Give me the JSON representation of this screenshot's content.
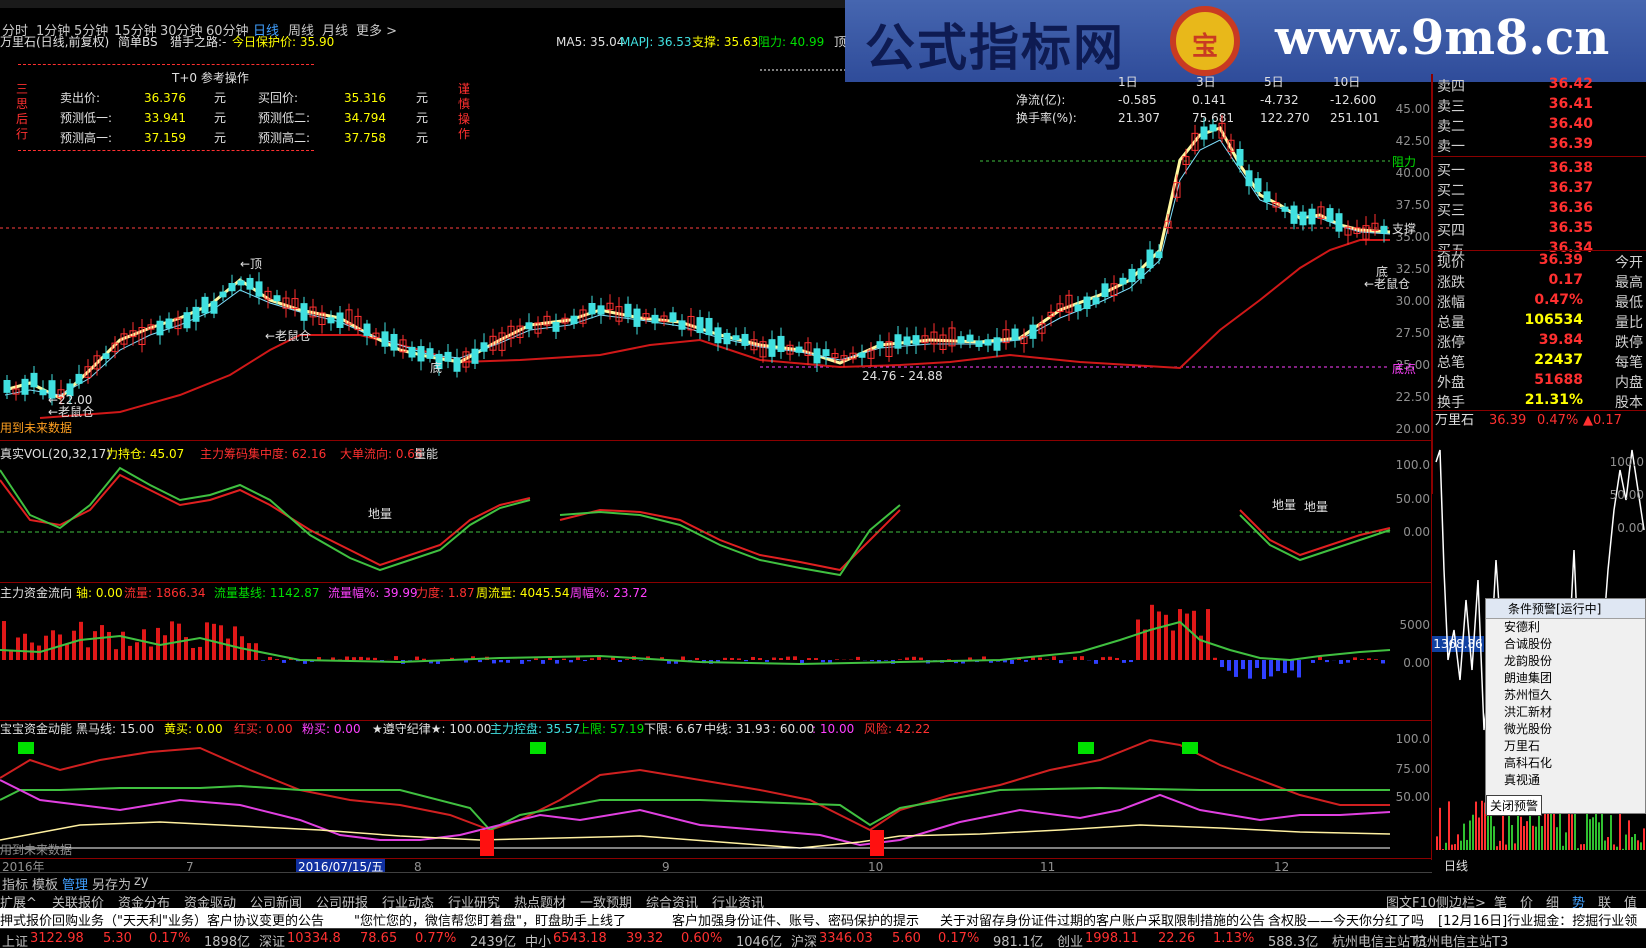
{
  "periods": [
    "分时",
    "1分钟",
    "5分钟",
    "15分钟",
    "30分钟",
    "60分钟",
    "日线",
    "周线",
    "月线",
    "更多 >"
  ],
  "banner": {
    "left": "公式指标网",
    "logo": "宝",
    "right": "www.9m8.cn"
  },
  "chart_header": {
    "title": "万里石(日线,前复权)",
    "mode": "简单BS",
    "hunter": "猎手之路:-",
    "protect": "今日保护价: 35.90",
    "ma5": "MA5: 35.04",
    "mapj": "MAPJ: 36.53",
    "support": "支撑: 35.63",
    "resist": "阻力: 40.99",
    "top": "顶"
  },
  "t0": {
    "title": "T+0 参考操作",
    "side_left": [
      "三",
      "思",
      "后",
      "行"
    ],
    "side_right": [
      "谨",
      "慎",
      "操",
      "作"
    ],
    "rows": [
      [
        "卖出价:",
        "36.376",
        "元",
        "买回价:",
        "35.316",
        "元"
      ],
      [
        "预测低一:",
        "33.941",
        "元",
        "预测低二:",
        "34.794",
        "元"
      ],
      [
        "预测高一:",
        "37.159",
        "元",
        "预测高二:",
        "37.758",
        "元"
      ]
    ]
  },
  "flow_table": {
    "headers": [
      "1日",
      "3日",
      "5日",
      "10日"
    ],
    "rows": [
      {
        "label": "净流(亿):",
        "values": [
          "-0.585",
          "0.141",
          "-4.732",
          "-12.600"
        ]
      },
      {
        "label": "换手率(%):",
        "values": [
          "21.307",
          "75.681",
          "122.270",
          "251.101"
        ]
      }
    ]
  },
  "main_axis": [
    "45.00",
    "42.50",
    "40.00",
    "37.50",
    "35.00",
    "32.50",
    "30.00",
    "27.50",
    "25.00",
    "22.50",
    "20.00"
  ],
  "annotations": {
    "resist": "阻力",
    "support": "支撑",
    "bottom": "底点",
    "ding": "←顶",
    "low_label": "←22.00",
    "laoshu1": "←老鼠仓",
    "laoshu2": "←老鼠仓",
    "laoshu3": "←老鼠仓",
    "di1": "底",
    "di2": "底",
    "range": "24.76 - 24.88",
    "future": "用到未来数据"
  },
  "vol_header": {
    "name": "真实VOL(20,32,17)",
    "a": "力持仓: 45.07",
    "b": "主力筹码集中度: 62.16",
    "c": "大单流向: 0.68",
    "d": "量能"
  },
  "vol_axis": [
    "100.0",
    "50.00",
    "0.00"
  ],
  "vol_marks": [
    "地量",
    "地量",
    "地量"
  ],
  "flow_header": {
    "name": "主力资金流向",
    "axis": "轴: 0.00",
    "flow": "流量: 1866.34",
    "base": "流量基线: 1142.87",
    "amp": "流量幅%: 39.99",
    "force": "力度: 1.87",
    "week": "周流量: 4045.54",
    "wamp": "周幅%: 23.72"
  },
  "flow_axis": [
    "5000",
    "0.00"
  ],
  "flow_value": "1368.86",
  "bao_header": {
    "name": "宝宝资金动能",
    "black": "黑马线: 15.00",
    "yellow": "黄买: 0.00",
    "red": "红买: 0.00",
    "pink": "粉买: 0.00",
    "rule": "★遵守纪律★: 100.00",
    "ctrl": "主力控盘: 35.57",
    "up": "上限: 57.19",
    "down": "下限: 6.67",
    "mid": "中线: 31.93",
    "p60": ": 60.00",
    "p10": ": 10.00",
    "risk": "风险: 42.22"
  },
  "bao_axis": [
    "100.0",
    "75.00",
    "50.00"
  ],
  "bao_future": "用到未来数据",
  "date_axis": {
    "year": "2016年",
    "m7": "7",
    "sel": "2016/07/15/五",
    "m8": "8",
    "m9": "9",
    "m10": "10",
    "m11": "11",
    "m12": "12",
    "rlabel": "日线"
  },
  "quote": {
    "asks": [
      {
        "label": "卖四",
        "price": "36.42"
      },
      {
        "label": "卖三",
        "price": "36.41"
      },
      {
        "label": "卖二",
        "price": "36.40"
      },
      {
        "label": "卖一",
        "price": "36.39"
      }
    ],
    "bids": [
      {
        "label": "买一",
        "price": "36.38"
      },
      {
        "label": "买二",
        "price": "36.37"
      },
      {
        "label": "买三",
        "price": "36.36"
      },
      {
        "label": "买四",
        "price": "36.35"
      },
      {
        "label": "买五",
        "price": "36.34"
      }
    ],
    "stats": [
      {
        "l": "现价",
        "v": "36.39",
        "l2": "今开"
      },
      {
        "l": "涨跌",
        "v": "0.17",
        "l2": "最高"
      },
      {
        "l": "涨幅",
        "v": "0.47%",
        "l2": "最低"
      },
      {
        "l": "总量",
        "v": "106534",
        "l2": "量比"
      },
      {
        "l": "涨停",
        "v": "39.84",
        "l2": "跌停"
      },
      {
        "l": "总笔",
        "v": "22437",
        "l2": "每笔"
      },
      {
        "l": "外盘",
        "v": "51688",
        "l2": "内盘"
      },
      {
        "l": "换手",
        "v": "21.31%",
        "l2": "股本"
      }
    ],
    "name": "万里石",
    "price": "36.39",
    "pct": "0.47%",
    "chg": "▲0.17"
  },
  "mini_axis": [
    "100.0",
    "50.00",
    "0.00"
  ],
  "popup": {
    "title": "条件预警[运行中]",
    "items": [
      "安德利",
      "合诚股份",
      "龙韵股份",
      "朗迪集团",
      "苏州恒久",
      "洪汇新材",
      "微光股份",
      "万里石",
      "高科石化",
      "真视通"
    ],
    "button": "关闭预警"
  },
  "tabs": [
    "指标",
    "模板",
    "管理",
    "另存为",
    "zy"
  ],
  "links": [
    "扩展^",
    "关联报价",
    "资金分布",
    "资金驱动",
    "公司新闻",
    "公司研报",
    "行业动态",
    "行业研究",
    "热点题材",
    "一致预期",
    "综合资讯",
    "行业资讯"
  ],
  "links_right": [
    "图文F10",
    "侧边栏>",
    "笔",
    "价",
    "细",
    "势",
    "联",
    "值"
  ],
  "news": [
    "押式报价回购业务（\"天天利\"业务）客户协议变更的公告",
    "\"您忙您的，微信帮您盯着盘\"，盯盘助手上线了",
    "客户加强身份证件、账号、密码保护的提示",
    "关于对留存身份证件过期的客户账户采取限制措施的公告",
    "含权股——今天你分红了吗",
    "[12月16日]行业掘金：挖掘行业领"
  ],
  "status": [
    {
      "t": "上证",
      "c": "#c0c0c0"
    },
    {
      "t": "3122.98",
      "c": "#ff3030"
    },
    {
      "t": "5.30",
      "c": "#ff3030"
    },
    {
      "t": "0.17%",
      "c": "#ff3030"
    },
    {
      "t": "1898亿",
      "c": "#c0c0c0"
    },
    {
      "t": "深证",
      "c": "#c0c0c0"
    },
    {
      "t": "10334.8",
      "c": "#ff3030"
    },
    {
      "t": "78.65",
      "c": "#ff3030"
    },
    {
      "t": "0.77%",
      "c": "#ff3030"
    },
    {
      "t": "2439亿",
      "c": "#c0c0c0"
    },
    {
      "t": "中小",
      "c": "#c0c0c0"
    },
    {
      "t": "6543.18",
      "c": "#ff3030"
    },
    {
      "t": "39.32",
      "c": "#ff3030"
    },
    {
      "t": "0.60%",
      "c": "#ff3030"
    },
    {
      "t": "1046亿",
      "c": "#c0c0c0"
    },
    {
      "t": "沪深",
      "c": "#c0c0c0"
    },
    {
      "t": "3346.03",
      "c": "#ff3030"
    },
    {
      "t": "5.60",
      "c": "#ff3030"
    },
    {
      "t": "0.17%",
      "c": "#ff3030"
    },
    {
      "t": "981.1亿",
      "c": "#c0c0c0"
    },
    {
      "t": "创业",
      "c": "#c0c0c0"
    },
    {
      "t": "1998.11",
      "c": "#ff3030"
    },
    {
      "t": "22.26",
      "c": "#ff3030"
    },
    {
      "t": "1.13%",
      "c": "#ff3030"
    },
    {
      "t": "588.3亿",
      "c": "#c0c0c0"
    },
    {
      "t": "杭州电信主站T3",
      "c": "#c0c0c0"
    },
    {
      "t": "杭州电信主站T3",
      "c": "#c0c0c0"
    }
  ]
}
